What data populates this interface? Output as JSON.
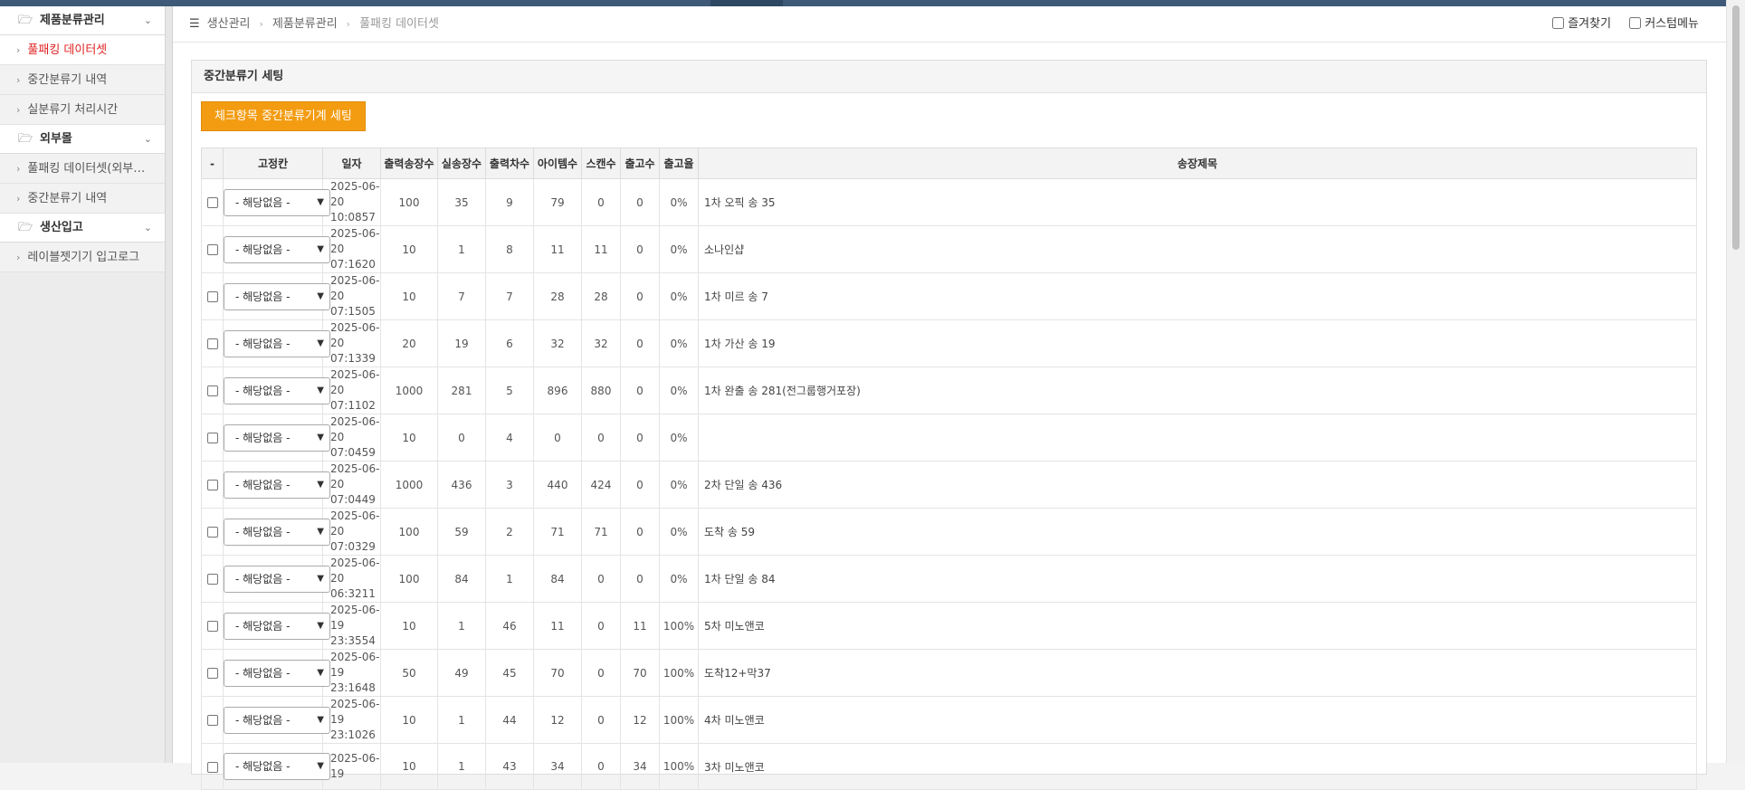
{
  "colors": {
    "topbar": "#3e5a78",
    "accent_orange": "#f39c12",
    "active_red": "#e02222"
  },
  "sidebar": {
    "groups": [
      {
        "label": "제품분류관리",
        "icon": "folder-open-icon",
        "items": [
          {
            "label": "풀패킹 데이터셋",
            "active": true
          },
          {
            "label": "중간분류기 내역"
          },
          {
            "label": "실분류기 처리시간"
          }
        ]
      },
      {
        "label": "외부몰",
        "icon": "folder-open-icon",
        "items": [
          {
            "label": "풀패킹 데이터셋(외부…"
          },
          {
            "label": "중간분류기 내역"
          }
        ]
      },
      {
        "label": "생산입고",
        "icon": "folder-open-icon",
        "items": [
          {
            "label": "레이블젯기기 입고로그"
          }
        ]
      }
    ]
  },
  "breadcrumb": {
    "items": [
      "생산관리",
      "제품분류관리",
      "풀패킹 데이터셋"
    ]
  },
  "topright": {
    "favorites": "즐겨찾기",
    "custom_menu": "커스텀메뉴"
  },
  "panel": {
    "title": "중간분류기 세팅",
    "set_button": "체크항목 중간분류기계 세팅",
    "select_default": "- 해당없음 -",
    "columns": [
      "-",
      "고정칸",
      "일자",
      "출력송장수",
      "실송장수",
      "출력차수",
      "아이템수",
      "스캔수",
      "출고수",
      "출고율",
      "송장제목"
    ],
    "rows": [
      {
        "date1": "2025-06-20",
        "date2": "10:0857",
        "out_inv": "100",
        "real_inv": "35",
        "round": "9",
        "items": "79",
        "scan": "0",
        "ship": "0",
        "rate": "0%",
        "title": "1차 오픽 송 35"
      },
      {
        "date1": "2025-06-20",
        "date2": "07:1620",
        "out_inv": "10",
        "real_inv": "1",
        "round": "8",
        "items": "11",
        "scan": "11",
        "ship": "0",
        "rate": "0%",
        "title": "소나인샵"
      },
      {
        "date1": "2025-06-20",
        "date2": "07:1505",
        "out_inv": "10",
        "real_inv": "7",
        "round": "7",
        "items": "28",
        "scan": "28",
        "ship": "0",
        "rate": "0%",
        "title": "1차 미르 송 7"
      },
      {
        "date1": "2025-06-20",
        "date2": "07:1339",
        "out_inv": "20",
        "real_inv": "19",
        "round": "6",
        "items": "32",
        "scan": "32",
        "ship": "0",
        "rate": "0%",
        "title": "1차 가산 송 19"
      },
      {
        "date1": "2025-06-20",
        "date2": "07:1102",
        "out_inv": "1000",
        "real_inv": "281",
        "round": "5",
        "items": "896",
        "scan": "880",
        "ship": "0",
        "rate": "0%",
        "title": "1차 완출 송 281(전그룹행거포장)"
      },
      {
        "date1": "2025-06-20",
        "date2": "07:0459",
        "out_inv": "10",
        "real_inv": "0",
        "round": "4",
        "items": "0",
        "scan": "0",
        "ship": "0",
        "rate": "0%",
        "title": ""
      },
      {
        "date1": "2025-06-20",
        "date2": "07:0449",
        "out_inv": "1000",
        "real_inv": "436",
        "round": "3",
        "items": "440",
        "scan": "424",
        "ship": "0",
        "rate": "0%",
        "title": "2차 단일 송 436"
      },
      {
        "date1": "2025-06-20",
        "date2": "07:0329",
        "out_inv": "100",
        "real_inv": "59",
        "round": "2",
        "items": "71",
        "scan": "71",
        "ship": "0",
        "rate": "0%",
        "title": "도착 송 59"
      },
      {
        "date1": "2025-06-20",
        "date2": "06:3211",
        "out_inv": "100",
        "real_inv": "84",
        "round": "1",
        "items": "84",
        "scan": "0",
        "ship": "0",
        "rate": "0%",
        "title": "1차 단일 송 84"
      },
      {
        "date1": "2025-06-19",
        "date2": "23:3554",
        "out_inv": "10",
        "real_inv": "1",
        "round": "46",
        "items": "11",
        "scan": "0",
        "ship": "11",
        "rate": "100%",
        "title": "5차 미노앤코"
      },
      {
        "date1": "2025-06-19",
        "date2": "23:1648",
        "out_inv": "50",
        "real_inv": "49",
        "round": "45",
        "items": "70",
        "scan": "0",
        "ship": "70",
        "rate": "100%",
        "title": "도착12+막37"
      },
      {
        "date1": "2025-06-19",
        "date2": "23:1026",
        "out_inv": "10",
        "real_inv": "1",
        "round": "44",
        "items": "12",
        "scan": "0",
        "ship": "12",
        "rate": "100%",
        "title": "4차 미노앤코"
      },
      {
        "date1": "2025-06-19",
        "date2": "",
        "out_inv": "10",
        "real_inv": "1",
        "round": "43",
        "items": "34",
        "scan": "0",
        "ship": "34",
        "rate": "100%",
        "title": "3차 미노앤코"
      }
    ]
  }
}
